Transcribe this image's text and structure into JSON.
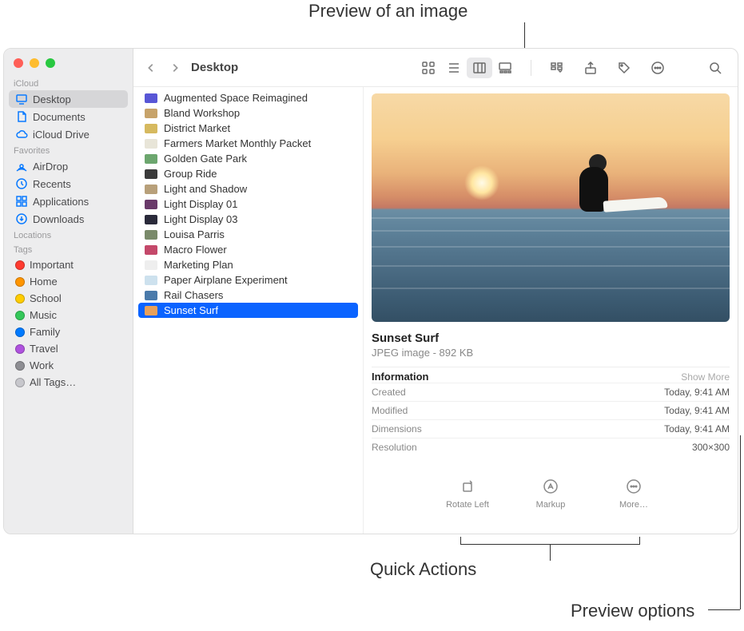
{
  "callouts": {
    "preview_image": "Preview of an image",
    "quick_actions": "Quick Actions",
    "preview_options": "Preview options"
  },
  "toolbar": {
    "title": "Desktop"
  },
  "sidebar": {
    "sections": [
      {
        "title": "iCloud",
        "items": [
          {
            "label": "Desktop",
            "icon": "desktop",
            "selected": true
          },
          {
            "label": "Documents",
            "icon": "document",
            "selected": false
          },
          {
            "label": "iCloud Drive",
            "icon": "cloud",
            "selected": false
          }
        ]
      },
      {
        "title": "Favorites",
        "items": [
          {
            "label": "AirDrop",
            "icon": "airdrop",
            "selected": false
          },
          {
            "label": "Recents",
            "icon": "clock",
            "selected": false
          },
          {
            "label": "Applications",
            "icon": "grid",
            "selected": false
          },
          {
            "label": "Downloads",
            "icon": "download",
            "selected": false
          }
        ]
      },
      {
        "title": "Locations",
        "items": []
      },
      {
        "title": "Tags",
        "items": [
          {
            "label": "Important",
            "color": "#ff3b30"
          },
          {
            "label": "Home",
            "color": "#ff9500"
          },
          {
            "label": "School",
            "color": "#ffcc00"
          },
          {
            "label": "Music",
            "color": "#34c759"
          },
          {
            "label": "Family",
            "color": "#007aff"
          },
          {
            "label": "Travel",
            "color": "#af52de"
          },
          {
            "label": "Work",
            "color": "#8e8e93"
          },
          {
            "label": "All Tags…",
            "color": "#c7c7cc"
          }
        ]
      }
    ]
  },
  "files": [
    {
      "name": "Augmented Space Reimagined",
      "thumb": "#5856d6"
    },
    {
      "name": "Bland Workshop",
      "thumb": "#c7a36a"
    },
    {
      "name": "District Market",
      "thumb": "#d6b95f"
    },
    {
      "name": "Farmers Market Monthly Packet",
      "thumb": "#e8e5d8"
    },
    {
      "name": "Golden Gate Park",
      "thumb": "#6ca66e"
    },
    {
      "name": "Group Ride",
      "thumb": "#3b3b3b"
    },
    {
      "name": "Light and Shadow",
      "thumb": "#b8a07a"
    },
    {
      "name": "Light Display 01",
      "thumb": "#6a3a6a"
    },
    {
      "name": "Light Display 03",
      "thumb": "#2a2a3a"
    },
    {
      "name": "Louisa Parris",
      "thumb": "#7a8a6a"
    },
    {
      "name": "Macro Flower",
      "thumb": "#c4486a"
    },
    {
      "name": "Marketing Plan",
      "thumb": "#eeeeee"
    },
    {
      "name": "Paper Airplane Experiment",
      "thumb": "#cde1ee"
    },
    {
      "name": "Rail Chasers",
      "thumb": "#4a7aaa"
    },
    {
      "name": "Sunset Surf",
      "thumb": "#e8a05a",
      "selected": true
    }
  ],
  "preview": {
    "title": "Sunset Surf",
    "subtitle": "JPEG image - 892 KB",
    "info_header": "Information",
    "show_more": "Show More",
    "rows": [
      {
        "label": "Created",
        "value": "Today, 9:41 AM"
      },
      {
        "label": "Modified",
        "value": "Today, 9:41 AM"
      },
      {
        "label": "Dimensions",
        "value": "Today, 9:41 AM"
      },
      {
        "label": "Resolution",
        "value": "300×300"
      }
    ]
  },
  "quick_actions": [
    {
      "label": "Rotate Left",
      "icon": "rotate"
    },
    {
      "label": "Markup",
      "icon": "markup"
    },
    {
      "label": "More…",
      "icon": "more"
    }
  ]
}
